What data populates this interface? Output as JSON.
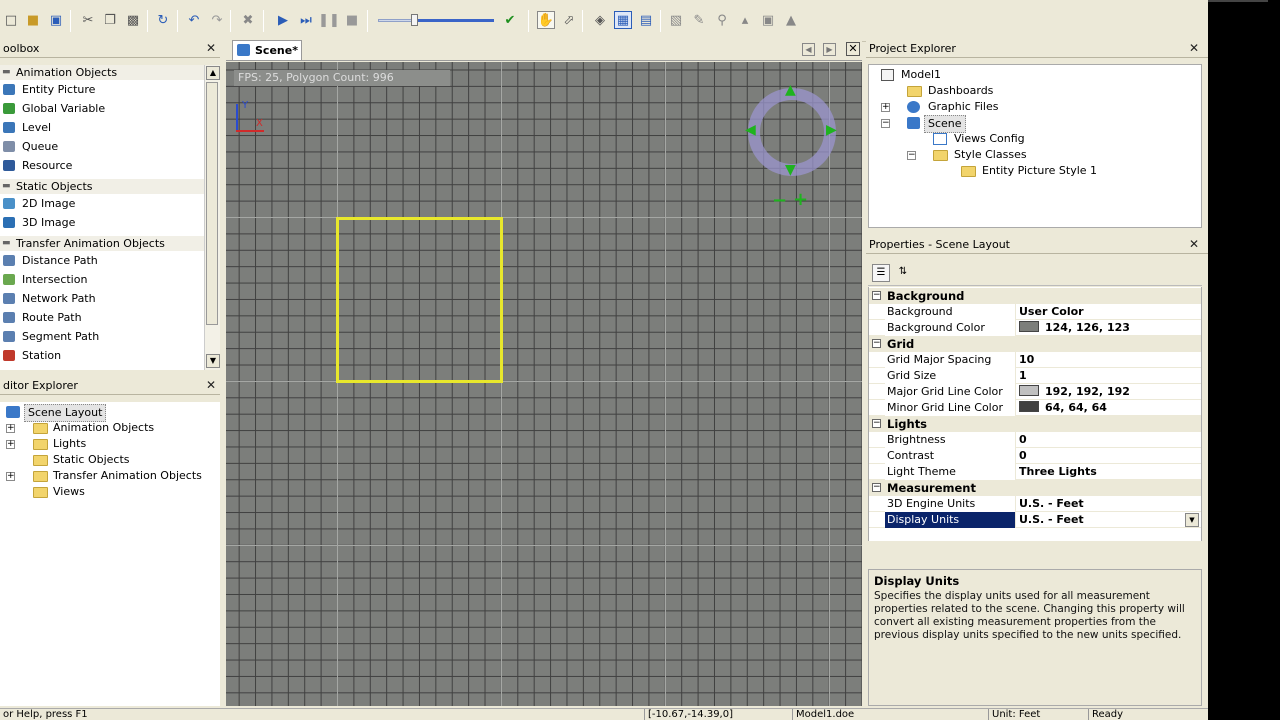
{
  "toolbar": {
    "buttons": [
      "new-icon",
      "open-icon",
      "save-icon",
      "cut-icon",
      "copy-icon",
      "paste-icon",
      "refresh-icon",
      "undo-icon",
      "redo-icon",
      "delete-icon",
      "play-icon",
      "step-icon",
      "pause-icon",
      "stop-icon",
      "check-icon",
      "hand-icon",
      "pointer-icon",
      "rotate-icon",
      "grid-icon",
      "layout-icon",
      "tool-a-icon",
      "tool-b-icon",
      "tool-c-icon",
      "tool-d-icon",
      "tool-e-icon"
    ],
    "speed_level": 0.33
  },
  "toolbox": {
    "title": "oolbox",
    "groups": [
      {
        "label": "Animation Objects",
        "items": [
          "Entity Picture",
          "Global Variable",
          "Level",
          "Queue",
          "Resource"
        ]
      },
      {
        "label": "Static Objects",
        "items": [
          "2D Image",
          "3D Image"
        ]
      },
      {
        "label": "Transfer Animation Objects",
        "items": [
          "Distance Path",
          "Intersection",
          "Network Path",
          "Route Path",
          "Segment Path",
          "Station"
        ]
      }
    ]
  },
  "editor_explorer": {
    "title": "ditor Explorer",
    "root": "Scene Layout",
    "children": [
      "Animation Objects",
      "Lights",
      "Static Objects",
      "Transfer Animation Objects",
      "Views"
    ]
  },
  "scene": {
    "tab_label": "Scene*",
    "fps_text": "FPS: 25, Polygon Count: 996",
    "axis_y": "Y",
    "axis_x": "X",
    "grid_color_bg": "#7c7e7b",
    "selection_color": "#e8e82c"
  },
  "project_explorer": {
    "title": "Project Explorer",
    "items": [
      "Model1",
      "Dashboards",
      "Graphic Files",
      "Scene",
      "Views Config",
      "Style Classes",
      "Entity Picture Style 1"
    ]
  },
  "properties": {
    "title": "Properties - Scene Layout",
    "categories": [
      {
        "name": "Background",
        "rows": [
          {
            "name": "Background",
            "value": "User Color"
          },
          {
            "name": "Background Color",
            "value": "124, 126, 123",
            "swatch": "#7c7e7b"
          }
        ]
      },
      {
        "name": "Grid",
        "rows": [
          {
            "name": "Grid Major Spacing",
            "value": "10"
          },
          {
            "name": "Grid Size",
            "value": "1"
          },
          {
            "name": "Major Grid Line Color",
            "value": "192, 192, 192",
            "swatch": "#c0c0c0"
          },
          {
            "name": "Minor Grid Line Color",
            "value": "64, 64, 64",
            "swatch": "#404040"
          }
        ]
      },
      {
        "name": "Lights",
        "rows": [
          {
            "name": "Brightness",
            "value": "0"
          },
          {
            "name": "Contrast",
            "value": "0"
          },
          {
            "name": "Light Theme",
            "value": "Three Lights"
          }
        ]
      },
      {
        "name": "Measurement",
        "rows": [
          {
            "name": "3D Engine Units",
            "value": "U.S. - Feet"
          },
          {
            "name": "Display Units",
            "value": "U.S. - Feet"
          }
        ]
      }
    ],
    "description": {
      "title": "Display Units",
      "text": "Specifies the display units used for all measurement properties related to the scene.  Changing this property will convert all existing measurement properties from the previous display units specified to the new units specified."
    }
  },
  "status": {
    "help": "or Help, press F1",
    "coords": "[-10.67,-14.39,0]",
    "file": "Model1.doe",
    "unit": "Unit: Feet",
    "state": "Ready"
  }
}
